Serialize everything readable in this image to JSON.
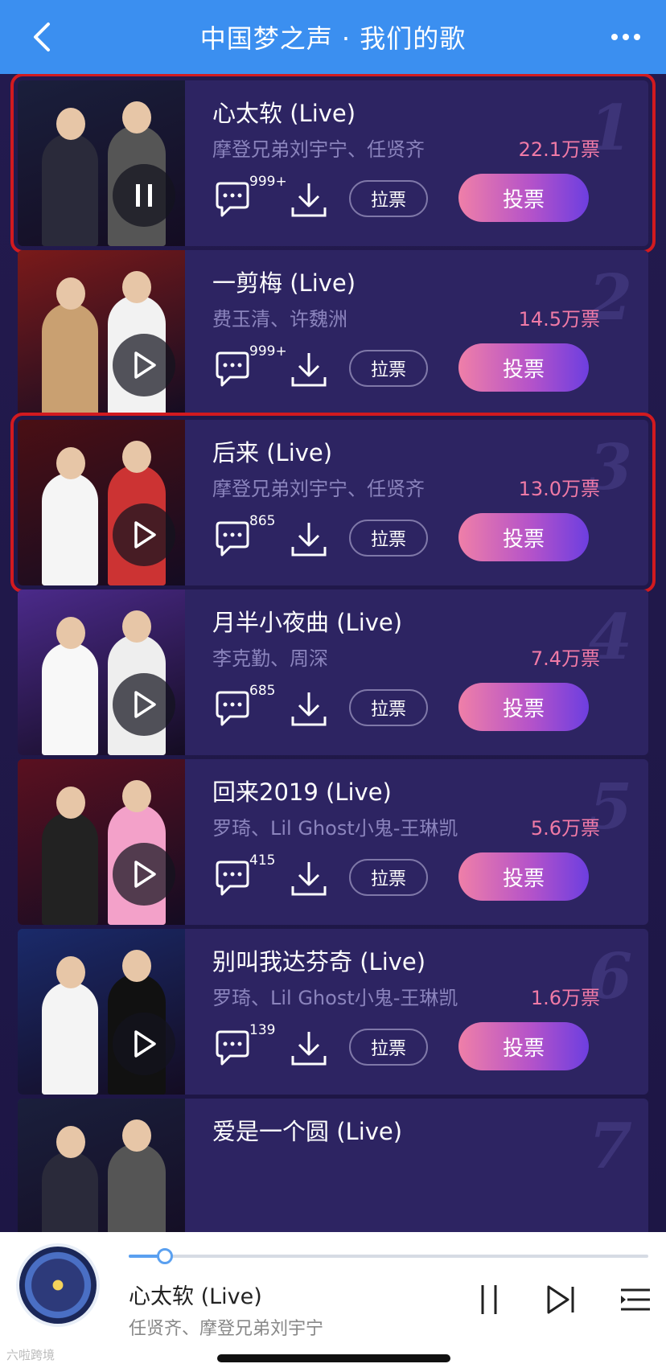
{
  "header": {
    "title": "中国梦之声 · 我们的歌",
    "back_icon": "chevron-left-icon",
    "more_icon": "ellipsis-icon"
  },
  "songs": [
    {
      "rank": "1",
      "title": "心太软 (Live)",
      "artists": "摩登兄弟刘宇宁、任贤齐",
      "votes": "22.1万票",
      "comments": "999+",
      "canvass": "拉票",
      "vote": "投票",
      "playing": true,
      "highlighted": true
    },
    {
      "rank": "2",
      "title": "一剪梅 (Live)",
      "artists": "费玉清、许魏洲",
      "votes": "14.5万票",
      "comments": "999+",
      "canvass": "拉票",
      "vote": "投票",
      "playing": false,
      "highlighted": false
    },
    {
      "rank": "3",
      "title": "后来 (Live)",
      "artists": "摩登兄弟刘宇宁、任贤齐",
      "votes": "13.0万票",
      "comments": "865",
      "canvass": "拉票",
      "vote": "投票",
      "playing": false,
      "highlighted": true
    },
    {
      "rank": "4",
      "title": "月半小夜曲 (Live)",
      "artists": "李克勤、周深",
      "votes": "7.4万票",
      "comments": "685",
      "canvass": "拉票",
      "vote": "投票",
      "playing": false,
      "highlighted": false
    },
    {
      "rank": "5",
      "title": "回来2019 (Live)",
      "artists": "罗琦、Lil Ghost小鬼-王琳凯",
      "votes": "5.6万票",
      "comments": "415",
      "canvass": "拉票",
      "vote": "投票",
      "playing": false,
      "highlighted": false
    },
    {
      "rank": "6",
      "title": "别叫我达芬奇 (Live)",
      "artists": "罗琦、Lil Ghost小鬼-王琳凯",
      "votes": "1.6万票",
      "comments": "139",
      "canvass": "拉票",
      "vote": "投票",
      "playing": false,
      "highlighted": false
    },
    {
      "rank": "7",
      "title": "爱是一个圆 (Live)",
      "artists": "",
      "votes": "",
      "comments": "",
      "canvass": "",
      "vote": "",
      "playing": false,
      "highlighted": false
    }
  ],
  "player": {
    "title": "心太软 (Live)",
    "artist": "任贤齐、摩登兄弟刘宇宁",
    "progress": 0.07,
    "pause_icon": "pause-icon",
    "next_icon": "next-track-icon",
    "playlist_icon": "playlist-icon"
  },
  "watermark": "六啦跨境",
  "colors": {
    "header_bg": "#3b8ff0",
    "page_bg": "#1c1640",
    "card_bg": "#2d2462",
    "vote_text": "#f07aa6",
    "highlight_border": "#d21a1f"
  }
}
